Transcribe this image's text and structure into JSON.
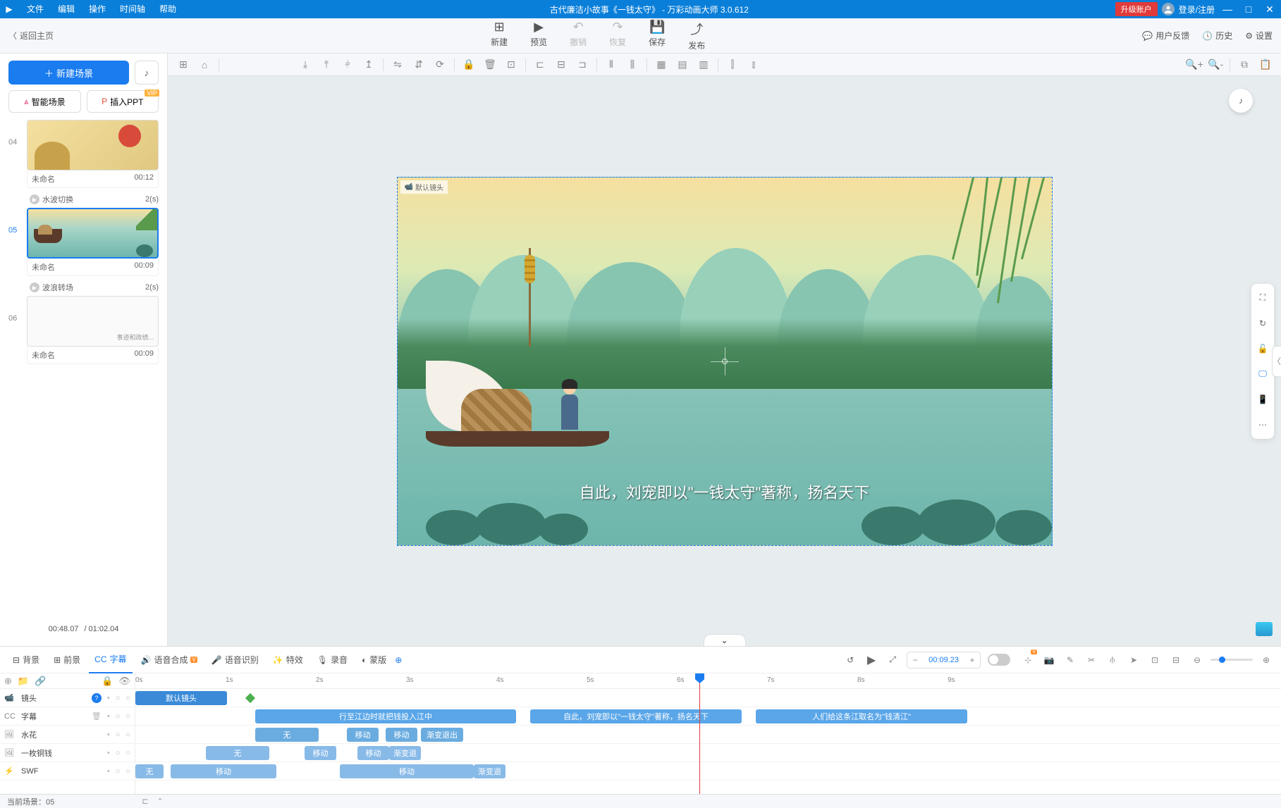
{
  "titlebar": {
    "menu": [
      "文件",
      "编辑",
      "操作",
      "时间轴",
      "帮助"
    ],
    "title": "古代廉洁小故事《一钱太守》 - 万彩动画大师 3.0.612",
    "upgrade": "升级账户",
    "login": "登录/注册"
  },
  "topbar": {
    "back": "返回主页",
    "actions": {
      "new": "新建",
      "preview": "预览",
      "undo": "撤销",
      "redo": "恢复",
      "save": "保存",
      "publish": "发布"
    },
    "right": {
      "feedback": "用户反馈",
      "history": "历史",
      "settings": "设置"
    }
  },
  "sidebar": {
    "newScene": "新建场景",
    "aiScene": "智能场景",
    "insertPpt": "插入PPT",
    "vipBadge": "VIP",
    "scenes": [
      {
        "num": "04",
        "name": "未命名",
        "dur": "00:12",
        "trans": "水波切换",
        "transDur": "2(s)"
      },
      {
        "num": "05",
        "name": "未命名",
        "dur": "00:09",
        "trans": "波浪转场",
        "transDur": "2(s)"
      },
      {
        "num": "06",
        "name": "未命名",
        "dur": "00:09"
      }
    ],
    "footer": {
      "current": "00:48.07",
      "total": "/ 01:02.04"
    }
  },
  "canvas": {
    "cameraLabel": "默认镜头",
    "subtitle": "自此，刘宠即以\"一钱太守\"著称，扬名天下"
  },
  "timeline": {
    "tabs": {
      "bg": "背景",
      "fg": "前景",
      "subtitle": "字幕",
      "tts": "语音合成",
      "asr": "语音识别",
      "fx": "特效",
      "record": "录音",
      "mask": "蒙版"
    },
    "currentTime": "00:09.23",
    "ruler": [
      "0s",
      "1s",
      "2s",
      "3s",
      "4s",
      "5s",
      "6s",
      "7s",
      "8s",
      "9s"
    ],
    "tracks": {
      "camera": "镜头",
      "subtitle": "字幕",
      "spray": "水花",
      "coin": "一枚铜钱",
      "swf": "SWF"
    },
    "clips": {
      "cameraDefault": "默认镜头",
      "sub1": "行至江边时就把钱投入江中",
      "sub2": "自此，刘宠即以\"一钱太守\"著称，扬名天下",
      "sub3": "人们给这条江取名为\"钱清江\"",
      "none": "无",
      "move": "移动",
      "fadeout": "渐变退出",
      "fadeout2": "渐变退"
    }
  },
  "statusbar": {
    "currentScene": "当前场景：05"
  }
}
